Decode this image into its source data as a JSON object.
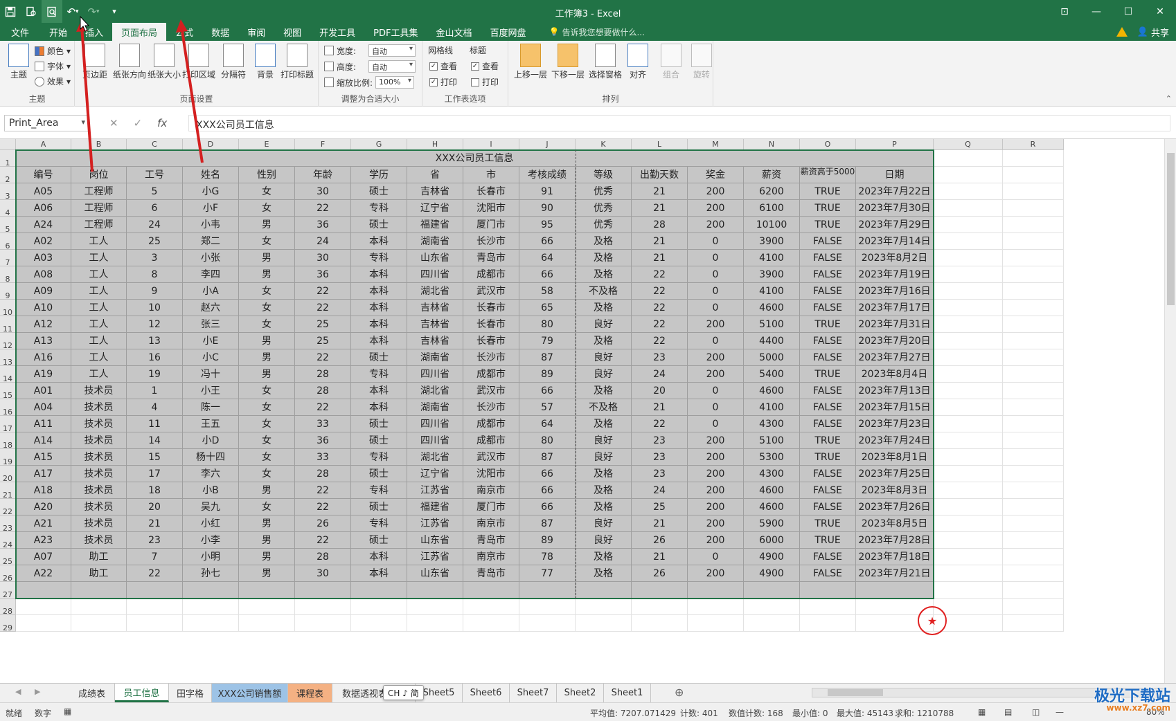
{
  "window": {
    "title": "工作簿3 - Excel"
  },
  "tabs": [
    "文件",
    "开始",
    "插入",
    "页面布局",
    "公式",
    "数据",
    "审阅",
    "视图",
    "开发工具",
    "PDF工具集",
    "金山文档",
    "百度网盘"
  ],
  "active_tab": "页面布局",
  "tell_me": "告诉我您想要做什么...",
  "share": "共享",
  "ribbon": {
    "theme": {
      "main": "主题",
      "colors": "颜色",
      "fonts": "字体",
      "effects": "效果",
      "group": "主题"
    },
    "page_setup": {
      "margins": "页边距",
      "orientation": "纸张方向",
      "size": "纸张大小",
      "print_area": "打印区域",
      "breaks": "分隔符",
      "background": "背景",
      "print_titles": "打印标题",
      "group": "页面设置"
    },
    "scale": {
      "width_label": "宽度:",
      "width_value": "自动",
      "height_label": "高度:",
      "height_value": "自动",
      "scale_label": "缩放比例:",
      "scale_value": "100%",
      "group": "调整为合适大小"
    },
    "sheet_options": {
      "gridlines": "网格线",
      "headings": "标题",
      "view": "查看",
      "print": "打印",
      "group": "工作表选项"
    },
    "arrange": {
      "bring_forward": "上移一层",
      "send_backward": "下移一层",
      "selection_pane": "选择窗格",
      "align": "对齐",
      "group_btn": "组合",
      "rotate": "旋转",
      "group": "排列"
    }
  },
  "formula_bar": {
    "name_box": "Print_Area",
    "formula": "XXX公司员工信息"
  },
  "columns": [
    "A",
    "B",
    "C",
    "D",
    "E",
    "F",
    "G",
    "H",
    "I",
    "J",
    "K",
    "L",
    "M",
    "N",
    "O",
    "P",
    "Q",
    "R"
  ],
  "sheet_title": "XXX公司员工信息",
  "headers": [
    "编号",
    "岗位",
    "工号",
    "姓名",
    "性别",
    "年龄",
    "学历",
    "省",
    "市",
    "考核成绩",
    "等级",
    "出勤天数",
    "奖金",
    "薪资",
    "薪资高于5000",
    "日期"
  ],
  "rows": [
    [
      "A05",
      "工程师",
      "5",
      "小G",
      "女",
      "30",
      "硕士",
      "吉林省",
      "长春市",
      "91",
      "优秀",
      "21",
      "200",
      "6200",
      "TRUE",
      "2023年7月22日"
    ],
    [
      "A06",
      "工程师",
      "6",
      "小F",
      "女",
      "22",
      "专科",
      "辽宁省",
      "沈阳市",
      "90",
      "优秀",
      "21",
      "200",
      "6100",
      "TRUE",
      "2023年7月30日"
    ],
    [
      "A24",
      "工程师",
      "24",
      "小韦",
      "男",
      "36",
      "硕士",
      "福建省",
      "厦门市",
      "95",
      "优秀",
      "28",
      "200",
      "10100",
      "TRUE",
      "2023年7月29日"
    ],
    [
      "A02",
      "工人",
      "25",
      "郑二",
      "女",
      "24",
      "本科",
      "湖南省",
      "长沙市",
      "66",
      "及格",
      "21",
      "0",
      "3900",
      "FALSE",
      "2023年7月14日"
    ],
    [
      "A03",
      "工人",
      "3",
      "小张",
      "男",
      "30",
      "专科",
      "山东省",
      "青岛市",
      "64",
      "及格",
      "21",
      "0",
      "4100",
      "FALSE",
      "2023年8月2日"
    ],
    [
      "A08",
      "工人",
      "8",
      "李四",
      "男",
      "36",
      "本科",
      "四川省",
      "成都市",
      "66",
      "及格",
      "22",
      "0",
      "3900",
      "FALSE",
      "2023年7月19日"
    ],
    [
      "A09",
      "工人",
      "9",
      "小A",
      "女",
      "22",
      "本科",
      "湖北省",
      "武汉市",
      "58",
      "不及格",
      "22",
      "0",
      "4100",
      "FALSE",
      "2023年7月16日"
    ],
    [
      "A10",
      "工人",
      "10",
      "赵六",
      "女",
      "22",
      "本科",
      "吉林省",
      "长春市",
      "65",
      "及格",
      "22",
      "0",
      "4600",
      "FALSE",
      "2023年7月17日"
    ],
    [
      "A12",
      "工人",
      "12",
      "张三",
      "女",
      "25",
      "本科",
      "吉林省",
      "长春市",
      "80",
      "良好",
      "22",
      "200",
      "5100",
      "TRUE",
      "2023年7月31日"
    ],
    [
      "A13",
      "工人",
      "13",
      "小E",
      "男",
      "25",
      "本科",
      "吉林省",
      "长春市",
      "79",
      "及格",
      "22",
      "0",
      "4400",
      "FALSE",
      "2023年7月20日"
    ],
    [
      "A16",
      "工人",
      "16",
      "小C",
      "男",
      "22",
      "硕士",
      "湖南省",
      "长沙市",
      "87",
      "良好",
      "23",
      "200",
      "5000",
      "FALSE",
      "2023年7月27日"
    ],
    [
      "A19",
      "工人",
      "19",
      "冯十",
      "男",
      "28",
      "专科",
      "四川省",
      "成都市",
      "89",
      "良好",
      "24",
      "200",
      "5400",
      "TRUE",
      "2023年8月4日"
    ],
    [
      "A01",
      "技术员",
      "1",
      "小王",
      "女",
      "28",
      "本科",
      "湖北省",
      "武汉市",
      "66",
      "及格",
      "20",
      "0",
      "4600",
      "FALSE",
      "2023年7月13日"
    ],
    [
      "A04",
      "技术员",
      "4",
      "陈一",
      "女",
      "22",
      "本科",
      "湖南省",
      "长沙市",
      "57",
      "不及格",
      "21",
      "0",
      "4100",
      "FALSE",
      "2023年7月15日"
    ],
    [
      "A11",
      "技术员",
      "11",
      "王五",
      "女",
      "33",
      "硕士",
      "四川省",
      "成都市",
      "64",
      "及格",
      "22",
      "0",
      "4300",
      "FALSE",
      "2023年7月23日"
    ],
    [
      "A14",
      "技术员",
      "14",
      "小D",
      "女",
      "36",
      "硕士",
      "四川省",
      "成都市",
      "80",
      "良好",
      "23",
      "200",
      "5100",
      "TRUE",
      "2023年7月24日"
    ],
    [
      "A15",
      "技术员",
      "15",
      "杨十四",
      "女",
      "33",
      "专科",
      "湖北省",
      "武汉市",
      "87",
      "良好",
      "23",
      "200",
      "5300",
      "TRUE",
      "2023年8月1日"
    ],
    [
      "A17",
      "技术员",
      "17",
      "李六",
      "女",
      "28",
      "硕士",
      "辽宁省",
      "沈阳市",
      "66",
      "及格",
      "23",
      "200",
      "4300",
      "FALSE",
      "2023年7月25日"
    ],
    [
      "A18",
      "技术员",
      "18",
      "小B",
      "男",
      "22",
      "专科",
      "江苏省",
      "南京市",
      "66",
      "及格",
      "24",
      "200",
      "4600",
      "FALSE",
      "2023年8月3日"
    ],
    [
      "A20",
      "技术员",
      "20",
      "吴九",
      "女",
      "22",
      "硕士",
      "福建省",
      "厦门市",
      "66",
      "及格",
      "25",
      "200",
      "4600",
      "FALSE",
      "2023年7月26日"
    ],
    [
      "A21",
      "技术员",
      "21",
      "小红",
      "男",
      "26",
      "专科",
      "江苏省",
      "南京市",
      "87",
      "良好",
      "21",
      "200",
      "5900",
      "TRUE",
      "2023年8月5日"
    ],
    [
      "A23",
      "技术员",
      "23",
      "小李",
      "男",
      "22",
      "硕士",
      "山东省",
      "青岛市",
      "89",
      "良好",
      "26",
      "200",
      "6000",
      "TRUE",
      "2023年7月28日"
    ],
    [
      "A07",
      "助工",
      "7",
      "小明",
      "男",
      "28",
      "本科",
      "江苏省",
      "南京市",
      "78",
      "及格",
      "21",
      "0",
      "4900",
      "FALSE",
      "2023年7月18日"
    ],
    [
      "A22",
      "助工",
      "22",
      "孙七",
      "男",
      "30",
      "本科",
      "山东省",
      "青岛市",
      "77",
      "及格",
      "26",
      "200",
      "4900",
      "FALSE",
      "2023年7月21日"
    ]
  ],
  "row_numbers": [
    "1",
    "2",
    "3",
    "4",
    "5",
    "6",
    "7",
    "8",
    "9",
    "10",
    "11",
    "12",
    "13",
    "14",
    "15",
    "16",
    "17",
    "18",
    "19",
    "20",
    "21",
    "22",
    "23",
    "24",
    "25",
    "26",
    "27",
    "28",
    "29"
  ],
  "sheet_tabs": [
    "成绩表",
    "员工信息",
    "田字格",
    "XXX公司销售额",
    "课程表",
    "数据透视表",
    "Sheet5",
    "Sheet6",
    "Sheet7",
    "Sheet2",
    "Sheet1"
  ],
  "active_sheet": "员工信息",
  "ime_indicator": "CH ♪ 简",
  "status": {
    "ready": "就绪",
    "mode": "数字",
    "average": "平均值: 7207.071429",
    "count": "计数: 401",
    "numeric_count": "数值计数: 168",
    "min": "最小值: 0",
    "max": "最大值: 45143",
    "sum": "求和: 1210788",
    "zoom": "80%"
  },
  "watermark": {
    "brand": "极光下载站",
    "url": "www.xz7.com"
  },
  "colors": {
    "excel_green": "#217346",
    "selection_gray": "#c6c6c6",
    "arrow_red": "#d42020"
  }
}
